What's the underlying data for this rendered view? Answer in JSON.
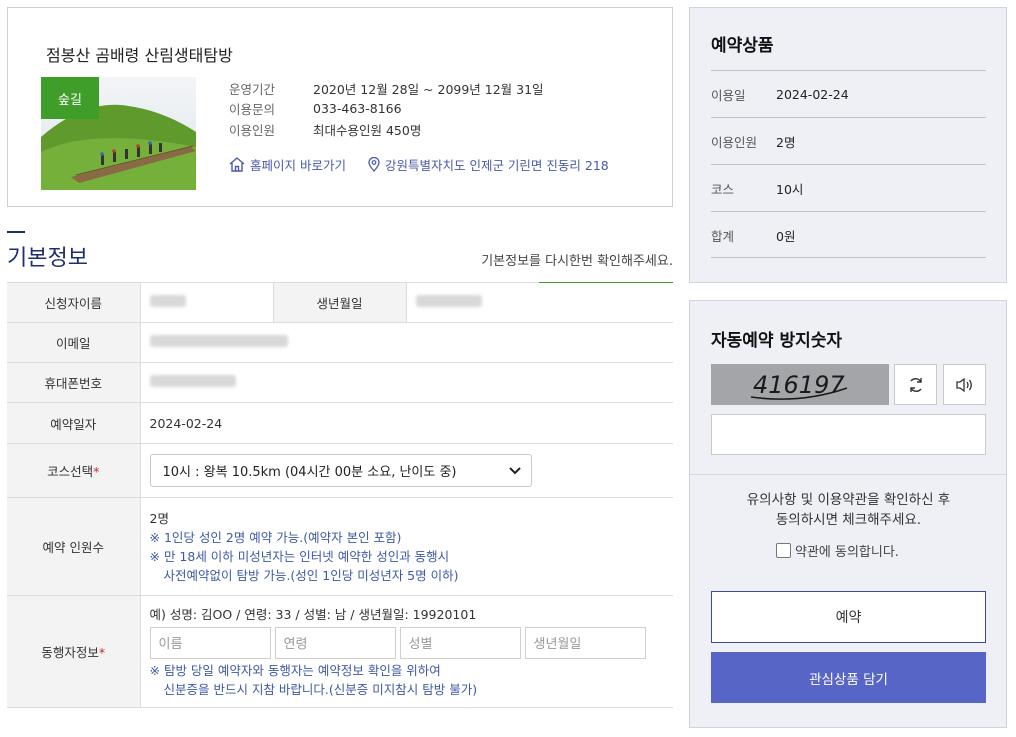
{
  "product": {
    "title": "점봉산 곰배령 산림생태탐방",
    "badge": "숲길",
    "info": [
      {
        "label": "운영기간",
        "value": "2020년 12월 28일 ~ 2099년 12월 31일"
      },
      {
        "label": "이용문의",
        "value": "033-463-8166"
      },
      {
        "label": "이용인원",
        "value": "최대수용인원 450명"
      }
    ],
    "homepage_link": "홈페이지 바로가기",
    "address": "강원특별자치도 인제군 기린면 진동리 218"
  },
  "basic_info": {
    "title": "기본정보",
    "hint": "기본정보를 다시한번 확인해주세요.",
    "applicant_label": "신청자이름",
    "birth_label": "생년월일",
    "email_label": "이메일",
    "phone_label": "휴대폰번호",
    "date_label": "예약일자",
    "date_value": "2024-02-24",
    "course_label": "코스선택",
    "required_mark": "*",
    "course_value": "10시 : 왕복 10.5km (04시간 00분 소요, 난이도 중)",
    "people_label": "예약 인원수",
    "people_value": "2명",
    "people_notes": [
      "※ 1인당 성인 2명 예약 가능.(예약자 본인 포함)",
      "※ 만 18세 이하 미성년자는 인터넷 예약한 성인과 동행시",
      "사전예약없이 탐방 가능.(성인 1인당 미성년자 5명 이하)"
    ],
    "companion_label": "동행자정보",
    "companion_example": "예) 성명: 김OO / 연령: 33 / 성별: 남 / 생년월일: 19920101",
    "companion_placeholders": {
      "name": "이름",
      "age": "연령",
      "gender": "성별",
      "birth": "생년월일"
    },
    "companion_notes": [
      "※ 탐방 당일 예약자와 동행자는 예약정보 확인을 위하여",
      "신분증을 반드시 지참 바랍니다.(신분증 미지참시 탐방 불가)"
    ]
  },
  "summary": {
    "title": "예약상품",
    "rows": [
      {
        "label": "이용일",
        "value": "2024-02-24"
      },
      {
        "label": "이용인원",
        "value": "2명"
      },
      {
        "label": "코스",
        "value": "10시"
      },
      {
        "label": "합계",
        "value": "0원"
      }
    ]
  },
  "captcha": {
    "title": "자동예약 방지숫자",
    "code": "416197",
    "message_line1": "유의사항 및 이용약관을 확인하신 후",
    "message_line2": "동의하시면 체크해주세요.",
    "agree_label": "약관에 동의합니다.",
    "reserve_button": "예약",
    "favorite_button": "관심상품 담기"
  },
  "colors": {
    "accent": "#1f2e6d",
    "green": "#3f9e2a",
    "button": "#5766c6",
    "note": "#3e5aa6"
  }
}
